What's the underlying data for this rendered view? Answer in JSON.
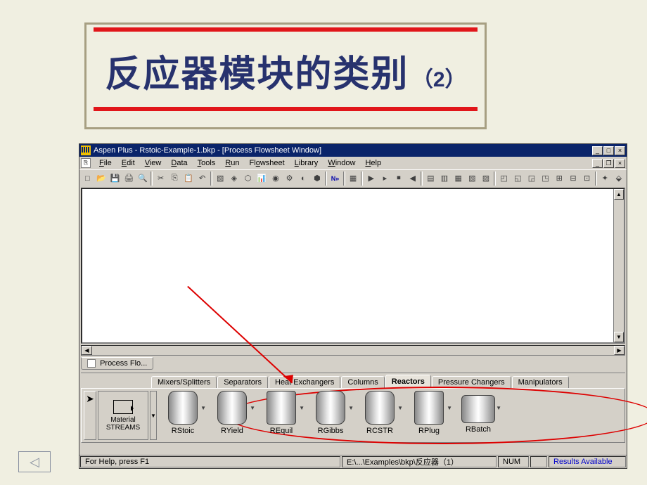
{
  "slide": {
    "title_main": "反应器模块的类别",
    "title_suffix": "（2）"
  },
  "app": {
    "title": "Aspen Plus - Rstoic-Example-1.bkp - [Process Flowsheet Window]",
    "win_min": "_",
    "win_max": "□",
    "win_close": "×",
    "child_min": "_",
    "child_restore": "❐",
    "child_close": "×"
  },
  "menu": {
    "file": "File",
    "edit": "Edit",
    "view": "View",
    "data": "Data",
    "tools": "Tools",
    "run": "Run",
    "flowsheet": "Flowsheet",
    "library": "Library",
    "window": "Window",
    "help": "Help"
  },
  "toolbar_icons": [
    "new",
    "open",
    "save",
    "print",
    "preview",
    "cut",
    "copy",
    "paste",
    "undo",
    "nav1",
    "nav2",
    "nav3",
    "nav4",
    "nav5",
    "nav6",
    "nav7",
    "nav8",
    "next",
    "sep",
    "step",
    "play",
    "stop",
    "rew",
    "sim1",
    "sim2",
    "sim3",
    "sim4",
    "sim5",
    "win1",
    "win2",
    "win3",
    "win4",
    "win5",
    "win6",
    "win7",
    "ext1",
    "ext2"
  ],
  "flowsheet_tab": "Process Flo...",
  "palette": {
    "tabs": {
      "mixers": "Mixers/Splitters",
      "separators": "Separators",
      "heatex": "Heat Exchangers",
      "columns": "Columns",
      "reactors": "Reactors",
      "pressure": "Pressure Changers",
      "manipulators": "Manipulators"
    },
    "streams_label1": "Material",
    "streams_label2": "STREAMS",
    "reactors": [
      "RStoic",
      "RYield",
      "REquil",
      "RGibbs",
      "RCSTR",
      "RPlug",
      "RBatch"
    ]
  },
  "status": {
    "help": "For Help, press F1",
    "path": "E:\\...\\Examples\\bkp\\反应器（1）",
    "num": "NUM",
    "results": "Results Available"
  },
  "nav_back": "◁"
}
